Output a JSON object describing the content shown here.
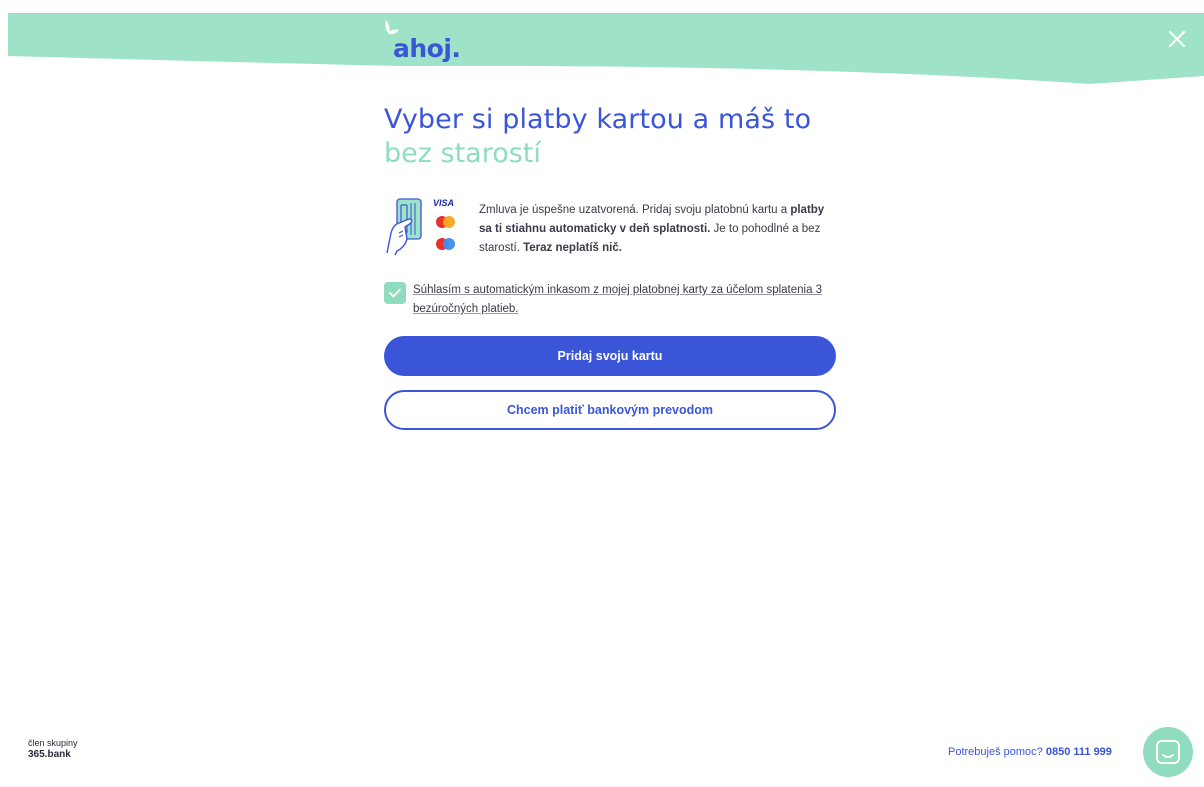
{
  "header": {
    "logo_text": "ahoj.",
    "close_icon": "close-icon",
    "band_color": "#9ee3c7"
  },
  "main": {
    "title": "Vyber si platby kartou a máš to",
    "subtitle": "bez starostí",
    "card_brands": {
      "visa": "VISA"
    },
    "info": {
      "part1": "Zmluva je úspešne uzatvorená. Pridaj svoju platobnú kartu a ",
      "bold1": "platby sa ti stiahnu automaticky v deň splatnosti.",
      "part2": " Je to pohodlné a bez starostí. ",
      "bold2": "Teraz neplatíš nič."
    },
    "consent": {
      "checked": true,
      "text": "Súhlasím s automatickým inkasom z mojej platobnej karty za účelom splatenia 3 bezúročných platieb."
    },
    "primary_button": "Pridaj svoju kartu",
    "secondary_button": "Chcem platiť bankovým prevodom"
  },
  "footer": {
    "member_label": "člen skupiny",
    "member_bank": "365.bank",
    "help_label": "Potrebuješ pomoc? ",
    "help_phone": "0850 111 999",
    "chat_icon": "chat-icon"
  },
  "colors": {
    "primary": "#3b55d9",
    "mint": "#8fdcbf",
    "header_mint": "#9ee3c7"
  }
}
